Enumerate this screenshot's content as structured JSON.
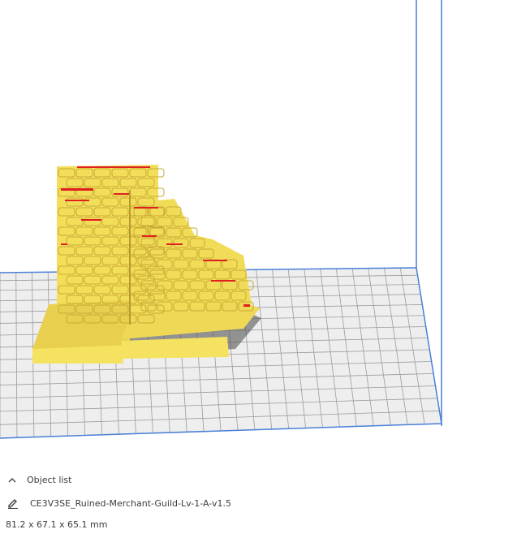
{
  "object_panel": {
    "header_label": "Object list",
    "object_name": "CE3V3SE_Ruined-Merchant-Guild-Lv-1-A-v1.5",
    "dimensions": "81.2 x 67.1 x 65.1 mm"
  },
  "colors": {
    "build_volume_edge": "#4a7fd6",
    "plate_grid": "#9a9a9a",
    "plate_fill": "#eaeaea",
    "model_fill": "#f7e46a",
    "model_shadow": "#c9a935",
    "overhang": "#e02020"
  },
  "icons": {
    "collapse": "chevron-up-icon",
    "edit": "pencil-icon"
  }
}
